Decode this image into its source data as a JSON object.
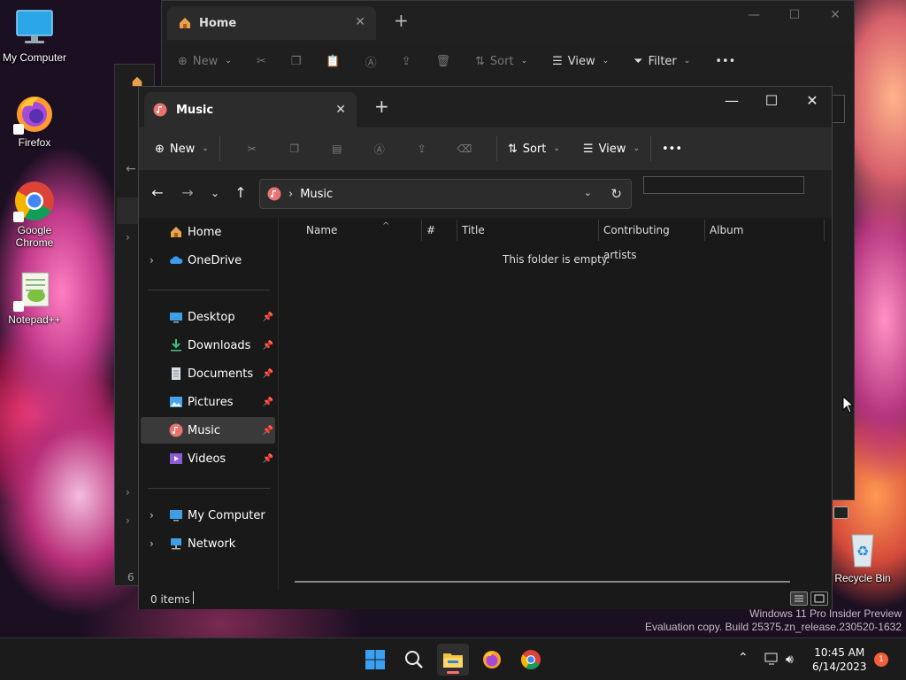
{
  "desktop": {
    "icons": [
      {
        "label": "My Computer",
        "icon": "monitor-icon"
      },
      {
        "label": "Firefox",
        "icon": "firefox-icon"
      },
      {
        "label": "Google Chrome",
        "icon": "chrome-icon"
      },
      {
        "label": "Notepad++",
        "icon": "notepadpp-icon"
      }
    ],
    "recycle_bin": {
      "label": "Recycle Bin",
      "icon": "recycle-bin-icon"
    },
    "watermark": {
      "line1": "Windows 11 Pro Insider Preview",
      "line2": "Evaluation copy. Build 25375.zn_release.230520-1632"
    }
  },
  "background_window": {
    "tab_label": "Home",
    "toolbar": {
      "new": "New",
      "sort": "Sort",
      "view": "View",
      "filter": "Filter"
    },
    "status_partial": "6"
  },
  "window": {
    "tab_label": "Music",
    "toolbar": {
      "new": "New",
      "sort": "Sort",
      "view": "View",
      "more": "•••"
    },
    "address": {
      "breadcrumb": "Music"
    },
    "sidebar": {
      "home": "Home",
      "onedrive": "OneDrive",
      "desktop": "Desktop",
      "downloads": "Downloads",
      "documents": "Documents",
      "pictures": "Pictures",
      "music": "Music",
      "videos": "Videos",
      "my_computer": "My Computer",
      "network": "Network"
    },
    "columns": {
      "name": "Name",
      "number": "#",
      "title": "Title",
      "contributing_artists": "Contributing artists",
      "album": "Album"
    },
    "empty_message": "This folder is empty.",
    "status": {
      "items": "0 items"
    }
  },
  "taskbar": {
    "apps": [
      {
        "name": "start-button",
        "icon": "windows-logo-icon"
      },
      {
        "name": "search-button",
        "icon": "search-icon"
      },
      {
        "name": "file-explorer",
        "icon": "folder-icon",
        "active": true
      },
      {
        "name": "firefox",
        "icon": "firefox-icon"
      },
      {
        "name": "chrome",
        "icon": "chrome-icon"
      }
    ],
    "clock": {
      "time": "10:45 AM",
      "date": "6/14/2023"
    },
    "notification_count": "1"
  },
  "colors": {
    "accent": "#0078d4",
    "notification": "#f25f3a",
    "file_explorer_indicator": "#ff6b6b"
  }
}
